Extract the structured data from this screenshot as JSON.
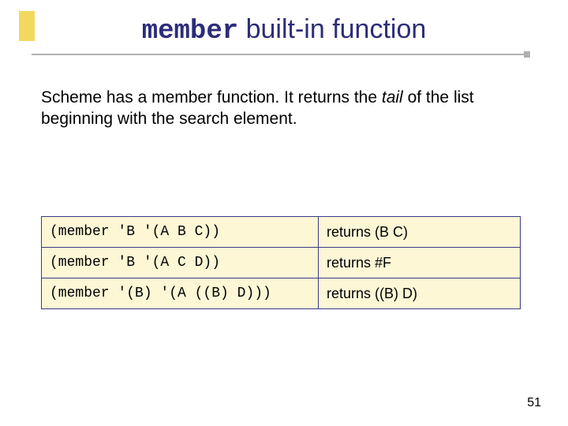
{
  "title": {
    "mono": "member",
    "rest": " built-in function"
  },
  "body": {
    "pre": "Scheme has a member function.  It returns the ",
    "italic": "tail",
    "post": " of the list beginning with the search element."
  },
  "examples": [
    {
      "code": "(member 'B '(A B C))",
      "result": "returns (B C)"
    },
    {
      "code": "(member 'B '(A C D))",
      "result": "returns #F"
    },
    {
      "code": "(member '(B) '(A ((B) D)))",
      "result": "returns ((B) D)"
    }
  ],
  "page_number": "51"
}
